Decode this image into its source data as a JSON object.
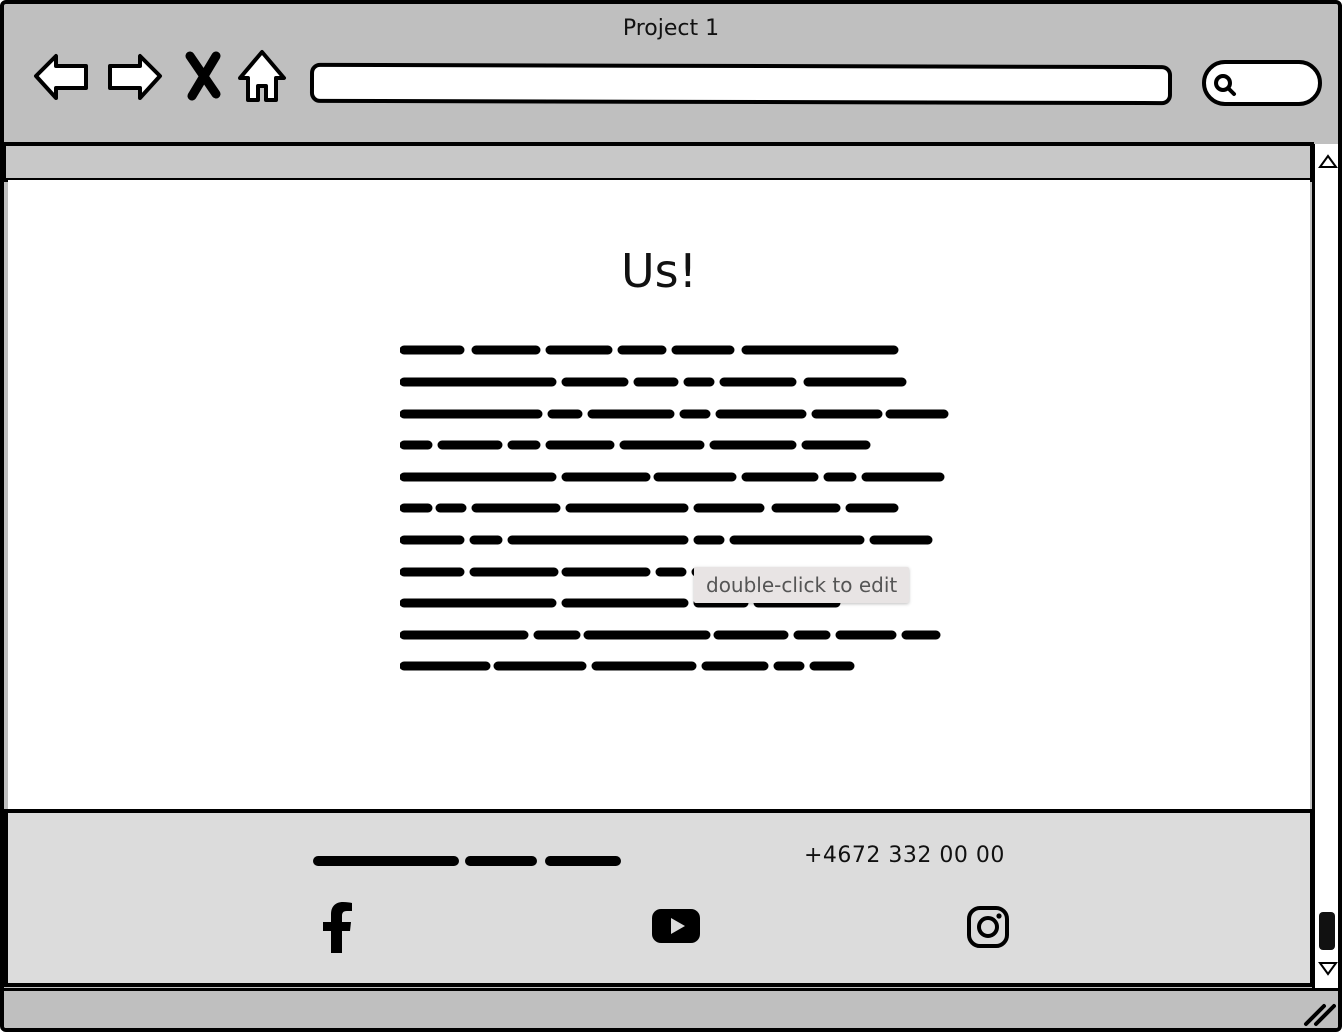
{
  "window": {
    "title": "Project 1"
  },
  "toolbar": {
    "back_icon": "back-arrow-icon",
    "forward_icon": "forward-arrow-icon",
    "stop_icon": "close-icon",
    "home_icon": "home-icon",
    "url_value": "",
    "search_icon": "search-icon"
  },
  "page": {
    "heading": "Us!",
    "tooltip": "double-click to edit"
  },
  "footer": {
    "phone": "+4672 332 00 00",
    "social": [
      "facebook-icon",
      "youtube-icon",
      "instagram-icon"
    ]
  },
  "colors": {
    "chrome": "#bfbfbf",
    "footer": "#dcdcdc",
    "ink": "#000000"
  }
}
